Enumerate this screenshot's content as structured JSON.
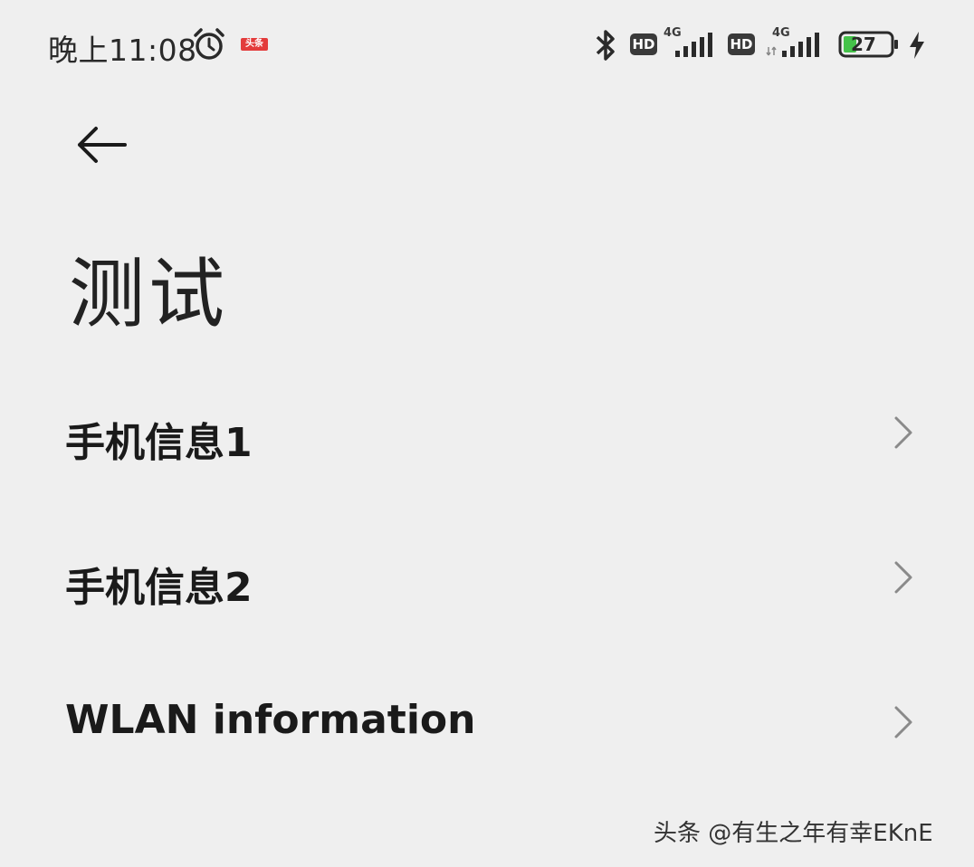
{
  "status_bar": {
    "time": "晚上11:08",
    "notification_badge": "头条",
    "sim1": {
      "hd": "HD",
      "network": "4G"
    },
    "sim2": {
      "hd": "HD",
      "network": "4G"
    },
    "battery": "27",
    "icons": [
      "alarm-icon",
      "bluetooth-icon",
      "signal-icon",
      "battery-icon",
      "charging-icon"
    ]
  },
  "header": {
    "back_icon": "arrow-left-icon",
    "title": "测试"
  },
  "list": {
    "items": [
      {
        "label": "手机信息1"
      },
      {
        "label": "手机信息2"
      },
      {
        "label": "WLAN information"
      }
    ]
  },
  "watermark": "头条 @有生之年有幸EKnE"
}
